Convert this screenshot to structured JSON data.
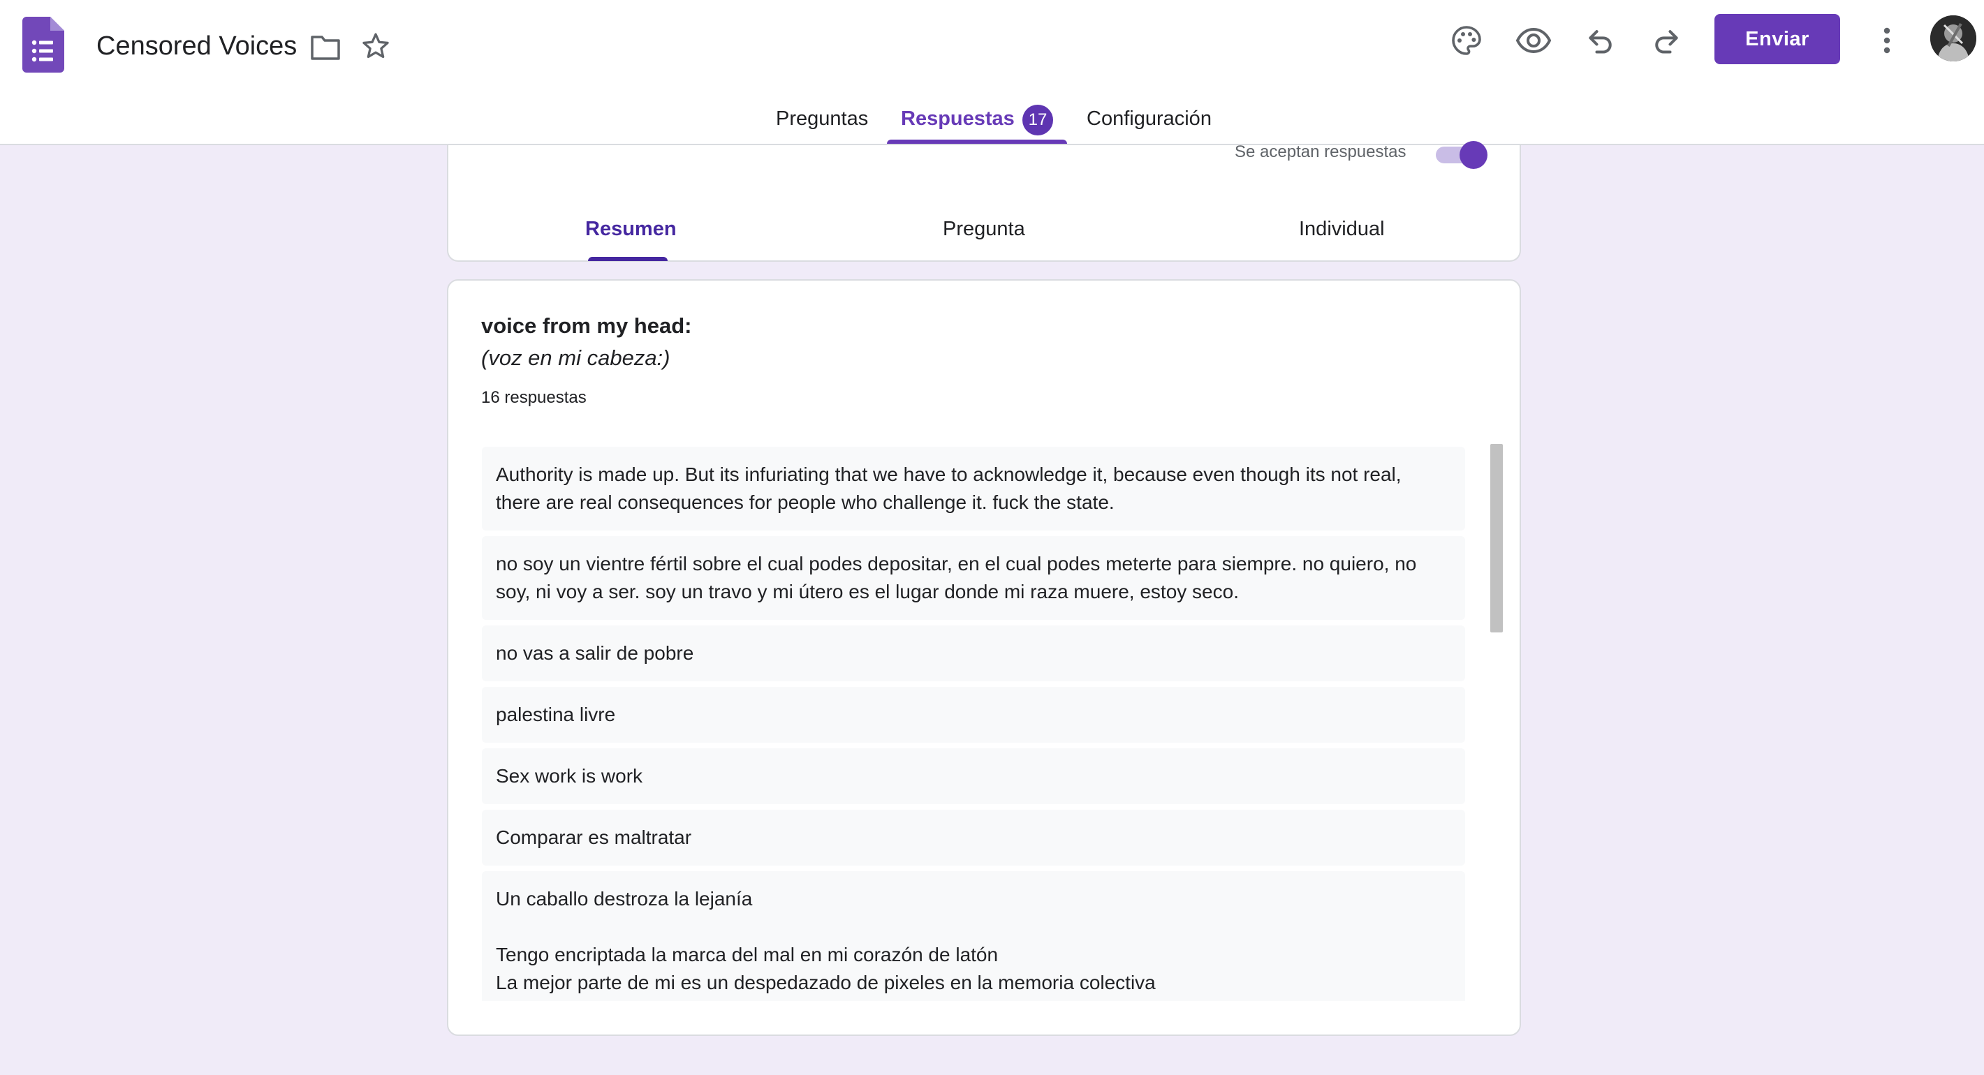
{
  "app": {
    "title": "Censored Voices",
    "logo_icon": "google-forms-icon",
    "accent_color": "#673ab7"
  },
  "toolbar": {
    "send_label": "Enviar",
    "icons": [
      "folder-icon",
      "star-icon",
      "palette-icon",
      "eye-icon",
      "undo-icon",
      "redo-icon",
      "more-vert-icon"
    ]
  },
  "tabs": {
    "questions": "Preguntas",
    "responses": "Respuestas",
    "responses_count": "17",
    "settings": "Configuración",
    "active": "responses"
  },
  "responses_panel": {
    "accepting_label": "Se aceptan respuestas",
    "accepting_on": true,
    "subtabs": {
      "summary": "Resumen",
      "question": "Pregunta",
      "individual": "Individual",
      "active": "summary"
    }
  },
  "question": {
    "title": "voice from my head:",
    "subtitle": "(voz en mi cabeza:)",
    "count_label": "16 respuestas",
    "answers": [
      "Authority is made up. But its infuriating that we have to acknowledge it, because even though its not real,\nthere are real consequences for people who challenge it. fuck the state.",
      "no soy un vientre fértil sobre el cual podes depositar, en el cual podes meterte para siempre. no quiero, no\nsoy, ni voy a ser. soy un travo y mi útero es el lugar donde mi raza muere, estoy seco.",
      "no vas a salir de pobre",
      "palestina livre",
      "Sex work is work",
      "Comparar es maltratar",
      "Un caballo destroza la lejanía\n\nTengo encriptada la marca del mal en mi corazón de latón\nLa mejor parte de mi es un despedazado de pixeles en la memoria colectiva"
    ]
  }
}
